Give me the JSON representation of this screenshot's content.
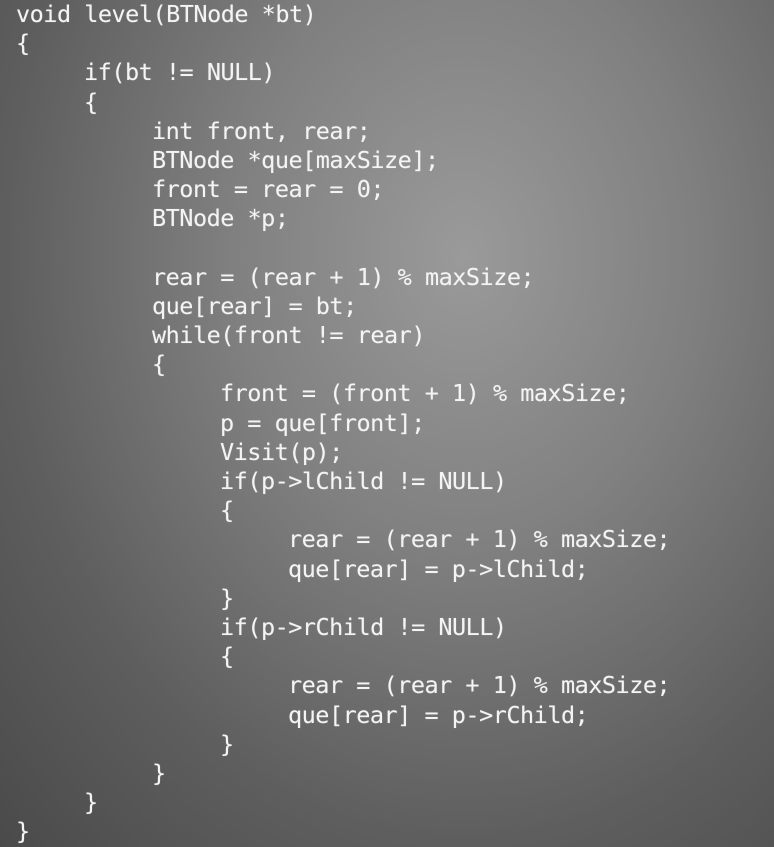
{
  "code": {
    "lines": [
      {
        "indent": 0,
        "text": "void level(BTNode *bt)"
      },
      {
        "indent": 0,
        "text": "{"
      },
      {
        "indent": 1,
        "text": "if(bt != NULL)"
      },
      {
        "indent": 1,
        "text": "{"
      },
      {
        "indent": 2,
        "text": "int front, rear;"
      },
      {
        "indent": 2,
        "text": "BTNode *que[maxSize];"
      },
      {
        "indent": 2,
        "text": "front = rear = 0;"
      },
      {
        "indent": 2,
        "text": "BTNode *p;"
      },
      {
        "indent": 0,
        "text": ""
      },
      {
        "indent": 2,
        "text": "rear = (rear + 1) % maxSize;"
      },
      {
        "indent": 2,
        "text": "que[rear] = bt;"
      },
      {
        "indent": 2,
        "text": "while(front != rear)"
      },
      {
        "indent": 2,
        "text": "{"
      },
      {
        "indent": 3,
        "text": "front = (front + 1) % maxSize;"
      },
      {
        "indent": 3,
        "text": "p = que[front];"
      },
      {
        "indent": 3,
        "text": "Visit(p);"
      },
      {
        "indent": 3,
        "text": "if(p->lChild != NULL)"
      },
      {
        "indent": 3,
        "text": "{"
      },
      {
        "indent": 4,
        "text": "rear = (rear + 1) % maxSize;"
      },
      {
        "indent": 4,
        "text": "que[rear] = p->lChild;"
      },
      {
        "indent": 3,
        "text": "}"
      },
      {
        "indent": 3,
        "text": "if(p->rChild != NULL)"
      },
      {
        "indent": 3,
        "text": "{"
      },
      {
        "indent": 4,
        "text": "rear = (rear + 1) % maxSize;"
      },
      {
        "indent": 4,
        "text": "que[rear] = p->rChild;"
      },
      {
        "indent": 3,
        "text": "}"
      },
      {
        "indent": 2,
        "text": "}"
      },
      {
        "indent": 1,
        "text": "}"
      },
      {
        "indent": 0,
        "text": "}"
      }
    ]
  }
}
